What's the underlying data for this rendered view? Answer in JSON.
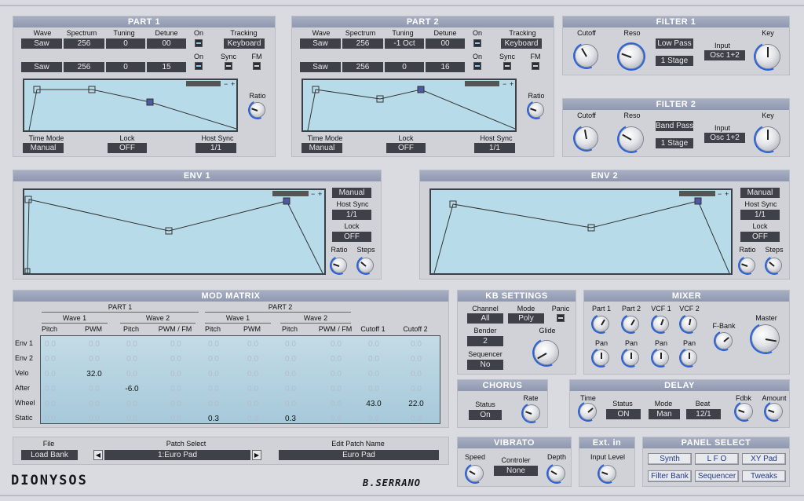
{
  "part1": {
    "title": "PART 1",
    "hdr": {
      "wave": "Wave",
      "spectrum": "Spectrum",
      "tuning": "Tuning",
      "detune": "Detune",
      "on": "On",
      "tracking": "Tracking",
      "sync": "Sync",
      "fm": "FM",
      "ratio": "Ratio"
    },
    "row1": {
      "wave": "Saw",
      "spectrum": "256",
      "tuning": "0",
      "detune": "00",
      "tracking": "Keyboard"
    },
    "row2": {
      "wave": "Saw",
      "spectrum": "256",
      "tuning": "0",
      "detune": "15"
    },
    "time_mode_label": "Time Mode",
    "time_mode": "Manual",
    "lock_label": "Lock",
    "lock": "OFF",
    "host_sync_label": "Host Sync",
    "host_sync": "1/1"
  },
  "part2": {
    "title": "PART 2",
    "row1": {
      "wave": "Saw",
      "spectrum": "256",
      "tuning": "-1 Oct",
      "detune": "00",
      "tracking": "Keyboard"
    },
    "row2": {
      "wave": "Saw",
      "spectrum": "256",
      "tuning": "0",
      "detune": "16"
    },
    "time_mode": "Manual",
    "lock": "OFF",
    "host_sync": "1/1"
  },
  "filter1": {
    "title": "FILTER 1",
    "cutoff": "Cutoff",
    "reso": "Reso",
    "type": "Low Pass",
    "stage": "1 Stage",
    "input_label": "Input",
    "input": "Osc 1+2",
    "key": "Key"
  },
  "filter2": {
    "title": "FILTER 2",
    "cutoff": "Cutoff",
    "reso": "Reso",
    "type": "Band Pass",
    "stage": "1 Stage",
    "input_label": "Input",
    "input": "Osc 1+2",
    "key": "Key"
  },
  "env1": {
    "title": "ENV 1",
    "mode": "Manual",
    "host_sync_label": "Host Sync",
    "host_sync": "1/1",
    "lock_label": "Lock",
    "lock": "OFF",
    "ratio": "Ratio",
    "steps": "Steps"
  },
  "env2": {
    "title": "ENV 2",
    "mode": "Manual",
    "host_sync_label": "Host Sync",
    "host_sync": "1/1",
    "lock_label": "Lock",
    "lock": "OFF",
    "ratio": "Ratio",
    "steps": "Steps"
  },
  "matrix": {
    "title": "MOD MATRIX",
    "part1": "PART 1",
    "part2": "PART 2",
    "groups": [
      "Wave 1",
      "Wave 2",
      "Wave 1",
      "Wave 2"
    ],
    "columns": [
      "Pitch",
      "PWM",
      "Pitch",
      "PWM / FM",
      "Pitch",
      "PWM",
      "Pitch",
      "PWM / FM",
      "Cutoff 1",
      "Cutoff 2"
    ],
    "rows": [
      {
        "name": "Env 1",
        "values": [
          "0.0",
          "0.0",
          "0.0",
          "0.0",
          "0.0",
          "0.0",
          "0.0",
          "0.0",
          "0.0",
          "0.0"
        ]
      },
      {
        "name": "Env 2",
        "values": [
          "0.0",
          "0.0",
          "0.0",
          "0.0",
          "0.0",
          "0.0",
          "0.0",
          "0.0",
          "0.0",
          "0.0"
        ]
      },
      {
        "name": "Velo",
        "values": [
          "0.0",
          "32.0",
          "0.0",
          "0.0",
          "0.0",
          "0.0",
          "0.0",
          "0.0",
          "0.0",
          "0.0"
        ]
      },
      {
        "name": "After",
        "values": [
          "0.0",
          "0.0",
          "-6.0",
          "0.0",
          "0.0",
          "0.0",
          "0.0",
          "0.0",
          "0.0",
          "0.0"
        ]
      },
      {
        "name": "Wheel",
        "values": [
          "0.0",
          "0.0",
          "0.0",
          "0.0",
          "0.0",
          "0.0",
          "0.0",
          "0.0",
          "43.0",
          "22.0"
        ]
      },
      {
        "name": "Static",
        "values": [
          "0.0",
          "0.0",
          "0.0",
          "0.0",
          "0.3",
          "0.0",
          "0.3",
          "0.0",
          "0.0",
          "0.0"
        ]
      }
    ]
  },
  "kb": {
    "title": "KB SETTINGS",
    "channel_label": "Channel",
    "channel": "All",
    "mode_label": "Mode",
    "mode": "Poly",
    "panic": "Panic",
    "bender_label": "Bender",
    "bender": "2",
    "glide": "Glide",
    "sequencer_label": "Sequencer",
    "sequencer": "No"
  },
  "mixer": {
    "title": "MIXER",
    "part1": "Part 1",
    "part2": "Part 2",
    "vcf1": "VCF 1",
    "vcf2": "VCF 2",
    "pan": "Pan",
    "fbank": "F-Bank",
    "master": "Master"
  },
  "chorus": {
    "title": "CHORUS",
    "status_label": "Status",
    "status": "On",
    "rate": "Rate"
  },
  "delay": {
    "title": "DELAY",
    "time": "Time",
    "status_label": "Status",
    "status": "ON",
    "mode_label": "Mode",
    "mode": "Man",
    "beat_label": "Beat",
    "beat": "12/1",
    "fdbk": "Fdbk",
    "amount": "Amount"
  },
  "patch": {
    "file_label": "File",
    "file": "Load Bank",
    "select_label": "Patch Select",
    "select": "1:Euro Pad",
    "edit_label": "Edit Patch Name",
    "edit": "Euro Pad"
  },
  "vibrato": {
    "title": "VIBRATO",
    "speed": "Speed",
    "controler_label": "Controler",
    "controler": "None",
    "depth": "Depth"
  },
  "extin": {
    "title": "Ext. in",
    "input_level": "Input Level"
  },
  "panel_select": {
    "title": "PANEL SELECT",
    "buttons": [
      "Synth",
      "L F O",
      "XY Pad",
      "Filter Bank",
      "Sequencer",
      "Tweaks"
    ]
  },
  "brand": {
    "logo": "DIONYSOS",
    "author": "B.SERRANO"
  }
}
